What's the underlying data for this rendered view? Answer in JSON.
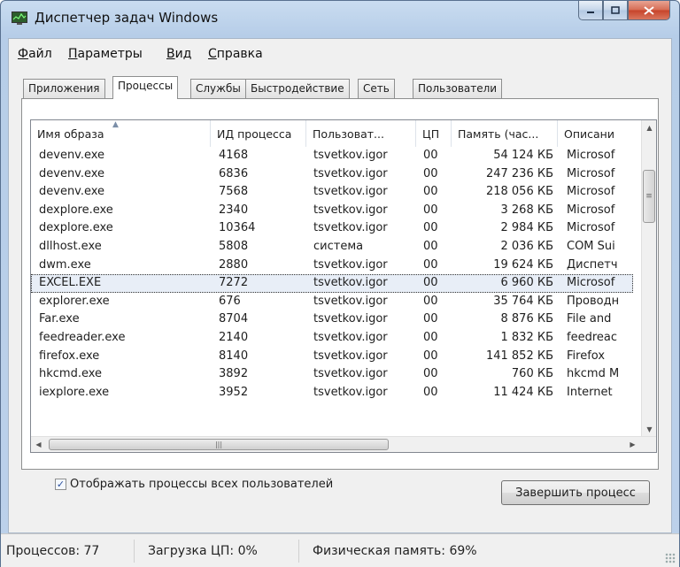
{
  "window": {
    "title": "Диспетчер задач Windows",
    "icons": {
      "app": "task-manager-icon",
      "minimize": "minimize-icon",
      "maximize": "maximize-icon",
      "close": "close-icon"
    }
  },
  "menu": {
    "items": [
      {
        "label": "Файл",
        "underline": "Ф"
      },
      {
        "label": "Параметры",
        "underline": "П"
      },
      {
        "label": "Вид",
        "underline": "В"
      },
      {
        "label": "Справка",
        "underline": "С"
      }
    ]
  },
  "tabs": [
    {
      "label": "Приложения",
      "active": false
    },
    {
      "label": "Процессы",
      "active": true
    },
    {
      "label": "Службы",
      "active": false
    },
    {
      "label": "Быстродействие",
      "active": false
    },
    {
      "label": "Сеть",
      "active": false
    },
    {
      "label": "Пользователи",
      "active": false
    }
  ],
  "processes": {
    "columns": {
      "name": "Имя образа",
      "pid": "ИД процесса",
      "user": "Пользоват...",
      "cpu": "ЦП",
      "mem": "Память (час...",
      "desc": "Описани"
    },
    "rows": [
      {
        "name": "devenv.exe",
        "pid": "4168",
        "user": "tsvetkov.igor",
        "cpu": "00",
        "mem": "54 124 КБ",
        "desc": "Microsof"
      },
      {
        "name": "devenv.exe",
        "pid": "6836",
        "user": "tsvetkov.igor",
        "cpu": "00",
        "mem": "247 236 КБ",
        "desc": "Microsof"
      },
      {
        "name": "devenv.exe",
        "pid": "7568",
        "user": "tsvetkov.igor",
        "cpu": "00",
        "mem": "218 056 КБ",
        "desc": "Microsof"
      },
      {
        "name": "dexplore.exe",
        "pid": "2340",
        "user": "tsvetkov.igor",
        "cpu": "00",
        "mem": "3 268 КБ",
        "desc": "Microsof"
      },
      {
        "name": "dexplore.exe",
        "pid": "10364",
        "user": "tsvetkov.igor",
        "cpu": "00",
        "mem": "2 984 КБ",
        "desc": "Microsof"
      },
      {
        "name": "dllhost.exe",
        "pid": "5808",
        "user": "система",
        "cpu": "00",
        "mem": "2 036 КБ",
        "desc": "COM Sui"
      },
      {
        "name": "dwm.exe",
        "pid": "2880",
        "user": "tsvetkov.igor",
        "cpu": "00",
        "mem": "19 624 КБ",
        "desc": "Диспетч"
      },
      {
        "name": "EXCEL.EXE",
        "pid": "7272",
        "user": "tsvetkov.igor",
        "cpu": "00",
        "mem": "6 960 КБ",
        "desc": "Microsof",
        "selected": true
      },
      {
        "name": "explorer.exe",
        "pid": "676",
        "user": "tsvetkov.igor",
        "cpu": "00",
        "mem": "35 764 КБ",
        "desc": "Проводн"
      },
      {
        "name": "Far.exe",
        "pid": "8704",
        "user": "tsvetkov.igor",
        "cpu": "00",
        "mem": "8 876 КБ",
        "desc": "File and"
      },
      {
        "name": "feedreader.exe",
        "pid": "2140",
        "user": "tsvetkov.igor",
        "cpu": "00",
        "mem": "1 832 КБ",
        "desc": "feedreac"
      },
      {
        "name": "firefox.exe",
        "pid": "8140",
        "user": "tsvetkov.igor",
        "cpu": "00",
        "mem": "141 852 КБ",
        "desc": "Firefox"
      },
      {
        "name": "hkcmd.exe",
        "pid": "3892",
        "user": "tsvetkov.igor",
        "cpu": "00",
        "mem": "760 КБ",
        "desc": "hkcmd M"
      },
      {
        "name": "iexplore.exe",
        "pid": "3952",
        "user": "tsvetkov.igor",
        "cpu": "00",
        "mem": "11 424 КБ",
        "desc": "Internet"
      }
    ]
  },
  "show_all_users": {
    "label": "Отображать процессы всех пользователей",
    "checked": true
  },
  "end_process_button": "Завершить процесс",
  "status": {
    "processes": "Процессов: 77",
    "cpu": "Загрузка ЦП: 0%",
    "memory": "Физическая память: 69%"
  }
}
